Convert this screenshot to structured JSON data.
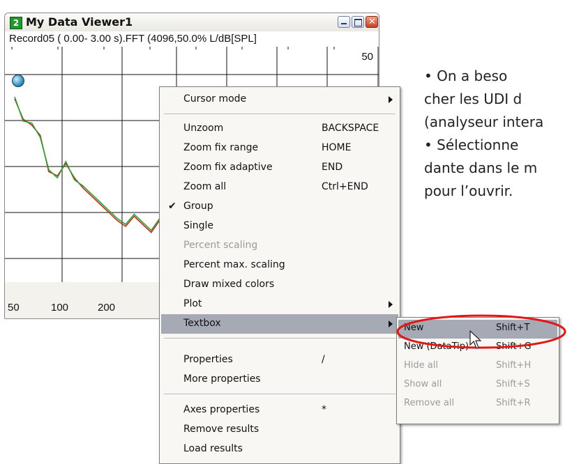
{
  "window": {
    "title": "My Data Viewer1",
    "icon_number": "2",
    "buttons": [
      "minimize-icon",
      "maximize-icon",
      "close-icon"
    ],
    "plot_header": "Record05 ( 0.00- 3.00 s).FFT (4096,50.0% L/dB[SPL]",
    "y_tick": "50",
    "x_ticks": [
      "50",
      "100",
      "200"
    ]
  },
  "chart_data": {
    "type": "line",
    "series": [
      {
        "color": "#d0281c",
        "values": [
          68,
          58,
          55,
          50,
          32,
          30,
          36,
          29,
          24,
          20,
          16,
          12,
          8,
          5,
          10,
          6,
          2,
          8
        ]
      },
      {
        "color": "#21a52d",
        "values": [
          69,
          57,
          56,
          49,
          33,
          29,
          37,
          28,
          25,
          21,
          17,
          13,
          9,
          6,
          11,
          7,
          3,
          9
        ]
      }
    ]
  },
  "context_menu": {
    "items": [
      {
        "label": "Cursor mode",
        "shortcut": "",
        "submenu": true
      },
      {
        "label": "Unzoom",
        "shortcut": "BACKSPACE"
      },
      {
        "label": "Zoom fix range",
        "shortcut": "HOME"
      },
      {
        "label": "Zoom fix adaptive",
        "shortcut": "END"
      },
      {
        "label": "Zoom all",
        "shortcut": "Ctrl+END"
      },
      {
        "label": "Group",
        "shortcut": "",
        "checked": true
      },
      {
        "label": "Single",
        "shortcut": ""
      },
      {
        "label": "Percent scaling",
        "shortcut": "",
        "disabled": true
      },
      {
        "label": "Percent max. scaling",
        "shortcut": ""
      },
      {
        "label": "Draw mixed colors",
        "shortcut": ""
      },
      {
        "label": "Plot",
        "shortcut": "",
        "submenu": true
      },
      {
        "label": "Textbox",
        "shortcut": "",
        "submenu": true,
        "highlighted": true
      },
      {
        "label": "Properties",
        "shortcut": "/"
      },
      {
        "label": "More properties",
        "shortcut": ""
      },
      {
        "label": "Axes properties",
        "shortcut": "*"
      },
      {
        "label": "Remove results",
        "shortcut": ""
      },
      {
        "label": "Load results",
        "shortcut": ""
      }
    ],
    "check_mark": "✔"
  },
  "textbox_submenu": {
    "items": [
      {
        "label": "New",
        "shortcut": "Shift+T",
        "highlighted": true
      },
      {
        "label": "New (DataTip)",
        "shortcut": "Shift+G"
      },
      {
        "label": "Hide all",
        "shortcut": "Shift+H",
        "disabled": true
      },
      {
        "label": "Show all",
        "shortcut": "Shift+S",
        "disabled": true
      },
      {
        "label": "Remove all",
        "shortcut": "Shift+R",
        "disabled": true
      }
    ]
  },
  "side_text": {
    "lines": [
      "• On a beso",
      "cher les UDI d",
      "(analyseur intera",
      "• Sélectionne",
      "dante dans le m",
      "pour l’ouvrir."
    ]
  }
}
